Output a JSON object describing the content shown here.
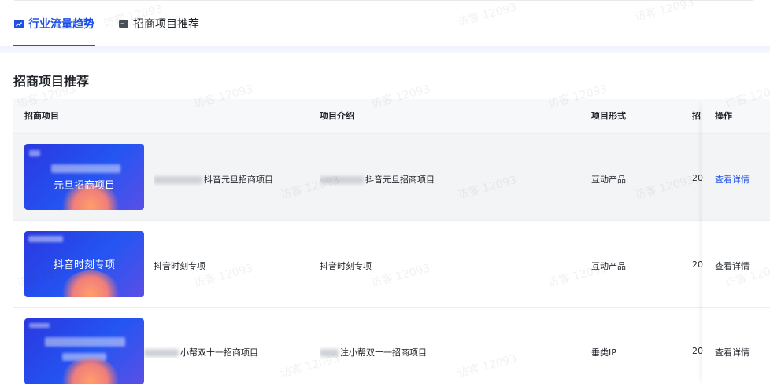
{
  "tabs": [
    {
      "label": "行业流量趋势",
      "icon": "trend-icon",
      "active": true
    },
    {
      "label": "招商项目推荐",
      "icon": "folder-icon",
      "active": false
    }
  ],
  "section_title": "招商项目推荐",
  "table": {
    "headers": {
      "project": "招商项目",
      "intro": "项目介绍",
      "form": "项目形式",
      "time": "招",
      "action": "操作"
    },
    "rows": [
      {
        "thumb_text": "元旦招商项目",
        "name": "抖音元旦招商项目",
        "intro": "抖音元旦招商项目",
        "form": "互动产品",
        "time": "20",
        "action": "查看详情"
      },
      {
        "thumb_text": "抖音时刻专项",
        "name": "抖音时刻专项",
        "intro": "抖音时刻专项",
        "form": "互动产品",
        "time": "20",
        "action": "查看详情"
      },
      {
        "thumb_text": "",
        "name": "小帮双十一招商项目",
        "intro": "注小帮双十一招商项目",
        "form": "垂类IP",
        "time": "20",
        "action": "查看详情"
      }
    ]
  },
  "watermark": "访客 12093",
  "colors": {
    "accent": "#1f50e6"
  }
}
